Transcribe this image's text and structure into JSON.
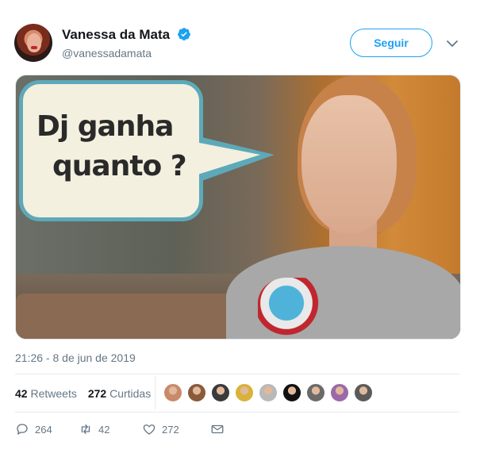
{
  "author": {
    "name": "Vanessa da Mata",
    "handle": "@vanessadamata",
    "verified": true
  },
  "follow_button": "Seguir",
  "media": {
    "bubble_line1": "Dj ganha",
    "bubble_line2": "quanto ?"
  },
  "timestamp": "21:26 - 8 de jun de 2019",
  "stats": {
    "retweets_count": "42",
    "retweets_label": "Retweets",
    "likes_count": "272",
    "likes_label": "Curtidas"
  },
  "likers": [
    "#c98a6a",
    "#8a5a3a",
    "#3a3a3a",
    "#d9b23a",
    "#b9b9b9",
    "#111111",
    "#6a6a6a",
    "#9a6aa8",
    "#5a5a5a"
  ],
  "actions": {
    "reply_count": "264",
    "retweet_count": "42",
    "like_count": "272"
  },
  "colors": {
    "accent": "#1da1f2",
    "secondary_text": "#657786",
    "bubble_border": "#5da9b9"
  }
}
